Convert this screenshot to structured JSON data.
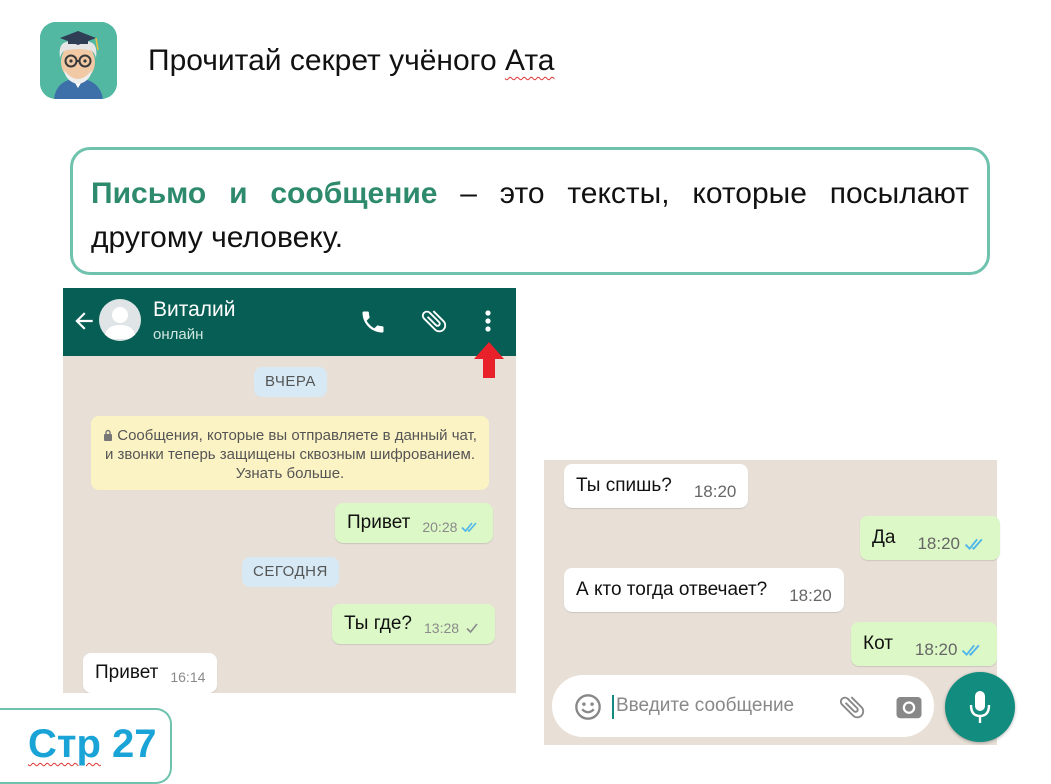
{
  "header": {
    "title_main": "Прочитай секрет учёного ",
    "title_name": "Ата"
  },
  "definition": {
    "term": "Письмо и сообщение",
    "text": " – это тексты, которые посылают другому человеку."
  },
  "chat1": {
    "contact_name": "Виталий",
    "contact_status": "онлайн",
    "date_yesterday": "ВЧЕРА",
    "encryption_note": "Сообщения, которые вы отправляете в данный чат, и звонки теперь защищены сквозным шифрованием. Узнать больше.",
    "date_today": "СЕГОДНЯ",
    "messages": [
      {
        "text": "Привет",
        "time": "20:28",
        "direction": "out",
        "read": true
      },
      {
        "text": "Ты где?",
        "time": "13:28",
        "direction": "out",
        "read": false
      },
      {
        "text": "Привет",
        "time": "16:14",
        "direction": "in"
      }
    ]
  },
  "chat2": {
    "messages": [
      {
        "text": "Ты спишь?",
        "time": "18:20",
        "direction": "in"
      },
      {
        "text": "Да",
        "time": "18:20",
        "direction": "out",
        "read": true
      },
      {
        "text": "А кто тогда отвечает?",
        "time": "18:20",
        "direction": "in"
      },
      {
        "text": "Кот",
        "time": "18:20",
        "direction": "out",
        "read": true
      }
    ],
    "input_placeholder": "Введите сообщение"
  },
  "page": {
    "label_word": "Стр",
    "label_number": " 27"
  },
  "colors": {
    "whatsapp_header": "#075e54",
    "outgoing_bubble": "#dcf8c6",
    "incoming_bubble": "#ffffff",
    "chat_wallpaper": "#e8e0d7",
    "read_ticks": "#4fb6ec",
    "accent_teal": "#6fc2ae",
    "term_green": "#2e8a6d",
    "page_blue": "#1aa3d6",
    "pointer_red": "#e8212a"
  },
  "icons": [
    "mascot-scientist",
    "back-arrow-icon",
    "phone-icon",
    "paperclip-icon",
    "more-vertical-icon",
    "pointer-arrow-icon",
    "lock-icon",
    "double-check-icon",
    "single-check-icon",
    "emoji-icon",
    "camera-icon",
    "mic-icon"
  ]
}
